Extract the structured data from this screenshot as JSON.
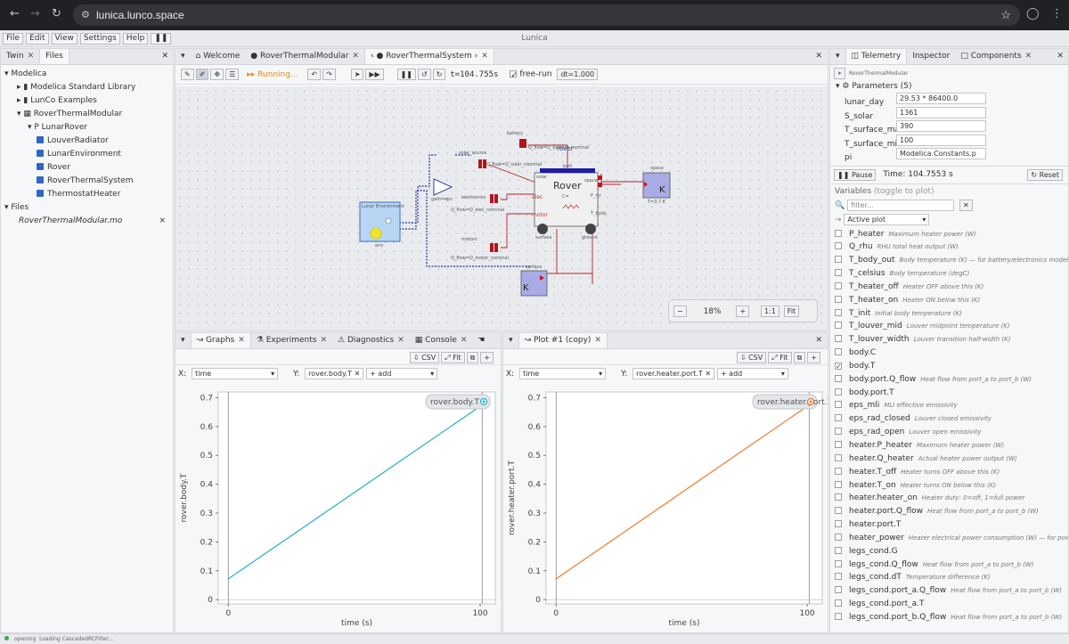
{
  "browser": {
    "url": "lunica.lunco.space"
  },
  "app": {
    "title": "Lunica"
  },
  "menu": [
    "File",
    "Edit",
    "View",
    "Settings",
    "Help"
  ],
  "left_tabs": [
    "Twin",
    "Files"
  ],
  "tree": {
    "root": "Modelica",
    "items": [
      "Modelica Standard Library",
      "LunCo Examples",
      "RoverThermalModular",
      "P LunarRover"
    ],
    "children": [
      "LouverRadiator",
      "LunarEnvironment",
      "Rover",
      "RoverThermalSystem",
      "ThermostatHeater"
    ],
    "files_label": "Files",
    "file": "RoverThermalModular.mo"
  },
  "center_tabs": [
    "Welcome",
    "RoverThermalModular",
    "RoverThermalSystem ›"
  ],
  "toolbar": {
    "running": "Running...",
    "t": "t=104.755s",
    "free_run": "free-run",
    "dt": "dt=1.000"
  },
  "diagram": {
    "battery": "battery",
    "rover_label": "rover",
    "solar_source": "solar_source",
    "electronics": "electronics",
    "motors": "motors",
    "space": "space",
    "surface": "surface",
    "rover_block": "Rover",
    "lunar_env": "Lunar Environment",
    "heat_flow_battery": "Q_flow=Q_battery_nominal",
    "heat_flow_solar": "Q_flow=Q_solar_nominal",
    "heat_flow_elec": "Q_flow=Q_elec_nominal",
    "heat_flow_motor": "Q_flow=Q_motor_nominal",
    "rover_ports": {
      "solar": "solar",
      "batt": "batt",
      "elec": "elec",
      "motor": "motor",
      "p_rtr": "P_rtr",
      "t_body": "T_body",
      "surface": "surface",
      "ground": "ground",
      "space": "space",
      "c": "C="
    },
    "env_sub": "env",
    "space_temp": "T=3.7 K",
    "gain_label": "gain=eps"
  },
  "zoom": {
    "minus": "−",
    "value": "18%",
    "plus": "+",
    "one": "1:1",
    "fit": "Fit"
  },
  "bottom_tabs": [
    "Graphs",
    "Experiments",
    "Diagnostics",
    "Console"
  ],
  "plot2_tab": "Plot #1 (copy)",
  "plot_buttons": {
    "csv": "CSV",
    "fit": "Fit"
  },
  "plot1": {
    "x_label": "X:",
    "x_value": "time",
    "y_label": "Y:",
    "y_chip": "rover.body.T",
    "add": "+ add",
    "legend": "rover.body.T"
  },
  "plot2": {
    "x_label": "X:",
    "x_value": "time",
    "y_label": "Y:",
    "y_chip": "rover.heater.port.T",
    "add": "+ add",
    "legend": "rover.heater.port.T"
  },
  "chart_data": [
    {
      "type": "line",
      "title": "",
      "xlabel": "time (s)",
      "ylabel": "rover.body.T",
      "x": [
        0,
        100.8
      ],
      "series": [
        {
          "name": "rover.body.T",
          "values": [
            0.072,
            0.675
          ],
          "color": "#26b0c8"
        }
      ],
      "xlim": [
        -4,
        106
      ],
      "ylim": [
        -0.015,
        0.72
      ],
      "xticks": [
        "0",
        "100"
      ],
      "yticks": [
        "0",
        "0.1",
        "0.2",
        "0.3",
        "0.4",
        "0.5",
        "0.6",
        "0.7"
      ],
      "grid": false,
      "legend": "top-right"
    },
    {
      "type": "line",
      "title": "",
      "xlabel": "time (s)",
      "ylabel": "rover.heater.port.T",
      "x": [
        0,
        100.8
      ],
      "series": [
        {
          "name": "rover.heater.port.T",
          "values": [
            0.072,
            0.675
          ],
          "color": "#ef7b2c"
        }
      ],
      "xlim": [
        -4,
        106
      ],
      "ylim": [
        -0.015,
        0.72
      ],
      "xticks": [
        "0",
        "100"
      ],
      "yticks": [
        "0",
        "0.1",
        "0.2",
        "0.3",
        "0.4",
        "0.5",
        "0.6",
        "0.7"
      ],
      "grid": false,
      "legend": "top-right"
    }
  ],
  "right_tabs": [
    "Telemetry",
    "Inspector",
    "Components"
  ],
  "telemetry": {
    "model": "RoverThermalModular",
    "params_title": "Parameters (5)",
    "params": [
      {
        "name": "lunar_day",
        "value": "29.53 * 86400.0"
      },
      {
        "name": "S_solar",
        "value": "1361"
      },
      {
        "name": "T_surface_max",
        "value": "390"
      },
      {
        "name": "T_surface_min",
        "value": "100"
      },
      {
        "name": "pi",
        "value": "Modelica.Constants.p"
      }
    ],
    "pause": "Pause",
    "time": "Time: 104.7553 s",
    "reset": "Reset",
    "variables_label": "Variables",
    "toggle": "(toggle to plot)",
    "filter": "filter...",
    "clear": "✕",
    "active_plot": "Active plot",
    "variables": [
      {
        "name": "P_heater",
        "desc": "Maximum heater power (W)",
        "checked": false
      },
      {
        "name": "Q_rhu",
        "desc": "RHU total heat output (W)",
        "checked": false
      },
      {
        "name": "T_body_out",
        "desc": "Body temperature (K) — for battery/electronics models",
        "checked": false
      },
      {
        "name": "T_celsius",
        "desc": "Body temperature (degC)",
        "checked": false
      },
      {
        "name": "T_heater_off",
        "desc": "Heater OFF above this (K)",
        "checked": false
      },
      {
        "name": "T_heater_on",
        "desc": "Heater ON below this (K)",
        "checked": false
      },
      {
        "name": "T_init",
        "desc": "Initial body temperature (K)",
        "checked": false
      },
      {
        "name": "T_louver_mid",
        "desc": "Louver midpoint temperature (K)",
        "checked": false
      },
      {
        "name": "T_louver_width",
        "desc": "Louver transition half-width (K)",
        "checked": false
      },
      {
        "name": "body.C",
        "desc": "",
        "checked": false
      },
      {
        "name": "body.T",
        "desc": "",
        "checked": true
      },
      {
        "name": "body.port.Q_flow",
        "desc": "Heat flow from port_a to port_b (W)",
        "checked": false
      },
      {
        "name": "body.port.T",
        "desc": "",
        "checked": false
      },
      {
        "name": "eps_mli",
        "desc": "MLI effective emissivity",
        "checked": false
      },
      {
        "name": "eps_rad_closed",
        "desc": "Louver closed emissivity",
        "checked": false
      },
      {
        "name": "eps_rad_open",
        "desc": "Louver open emissivity",
        "checked": false
      },
      {
        "name": "heater.P_heater",
        "desc": "Maximum heater power (W)",
        "checked": false
      },
      {
        "name": "heater.Q_heater",
        "desc": "Actual heater power output (W)",
        "checked": false
      },
      {
        "name": "heater.T_off",
        "desc": "Heater turns OFF above this (K)",
        "checked": false
      },
      {
        "name": "heater.T_on",
        "desc": "Heater turns ON below this (K)",
        "checked": false
      },
      {
        "name": "heater.heater_on",
        "desc": "Heater duty: 0=off, 1=full power",
        "checked": false
      },
      {
        "name": "heater.port.Q_flow",
        "desc": "Heat flow from port_a to port_b (W)",
        "checked": false
      },
      {
        "name": "heater.port.T",
        "desc": "",
        "checked": false
      },
      {
        "name": "heater_power",
        "desc": "Heater electrical power consumption (W) — for power budget",
        "checked": false
      },
      {
        "name": "legs_cond.G",
        "desc": "",
        "checked": false
      },
      {
        "name": "legs_cond.Q_flow",
        "desc": "Heat flow from port_a to port_b (W)",
        "checked": false
      },
      {
        "name": "legs_cond.dT",
        "desc": "Temperature difference (K)",
        "checked": false
      },
      {
        "name": "legs_cond.port_a.Q_flow",
        "desc": "Heat flow from port_a to port_b (W)",
        "checked": false
      },
      {
        "name": "legs_cond.port_a.T",
        "desc": "",
        "checked": false
      },
      {
        "name": "legs_cond.port_b.Q_flow",
        "desc": "Heat flow from port_a to port_b (W)",
        "checked": false
      }
    ]
  },
  "status": {
    "state": "opening",
    "message": "Loading CascadedRCFilter..."
  }
}
